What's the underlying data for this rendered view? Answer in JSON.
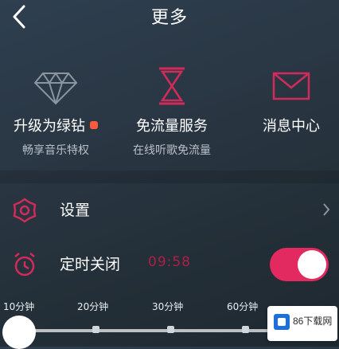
{
  "header": {
    "title": "更多"
  },
  "features": [
    {
      "icon": "diamond-icon",
      "title": "升级为绿钻",
      "subtitle": "畅享音乐特权",
      "badge": true
    },
    {
      "icon": "hourglass-icon",
      "title": "免流量服务",
      "subtitle": "在线听歌免流量"
    },
    {
      "icon": "envelope-icon",
      "title": "消息中心"
    }
  ],
  "settings_row": {
    "icon": "gear-icon",
    "label": "设置"
  },
  "timer_row": {
    "icon": "alarm-clock-icon",
    "label": "定时关闭",
    "value": "09:58",
    "toggle_on": true
  },
  "timer_slider": {
    "options": [
      "10分钟",
      "20分钟",
      "30分钟",
      "60分钟"
    ],
    "selected": "10分钟"
  },
  "colors": {
    "accent": "#e32a60",
    "badge": "#ff5a3c",
    "icon_pink": "#d22a5a",
    "icon_gray": "#8a95a0"
  },
  "watermark": {
    "text": "86下载网"
  }
}
